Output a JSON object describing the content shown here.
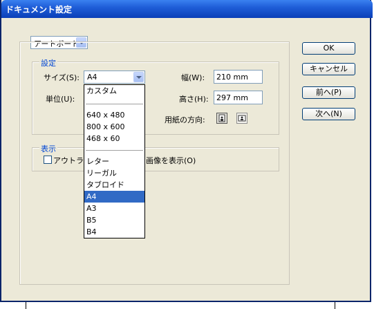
{
  "window": {
    "title": "ドキュメント設定"
  },
  "artboard_combo": {
    "value": "アートボード"
  },
  "settings": {
    "legend": "設定",
    "size_label": "サイズ(S):",
    "size_value": "A4",
    "unit_label": "単位(U):",
    "width_label": "幅(W):",
    "width_value": "210 mm",
    "height_label": "高さ(H):",
    "height_value": "297 mm",
    "orientation_label": "用紙の方向:"
  },
  "display": {
    "legend": "表示",
    "outline_left": "アウトライ",
    "outline_right": "画像を表示(O)"
  },
  "dropdown": {
    "group1": [
      "カスタム"
    ],
    "group2": [
      "640 x 480",
      "800 x 600",
      "468 x 60"
    ],
    "group3": [
      "レター",
      "リーガル",
      "タブロイド",
      "A4",
      "A3",
      "B5",
      "B4"
    ],
    "selected": "A4"
  },
  "buttons": {
    "ok": "OK",
    "cancel": "キャンセル",
    "prev": "前へ(P)",
    "next": "次へ(N)"
  }
}
